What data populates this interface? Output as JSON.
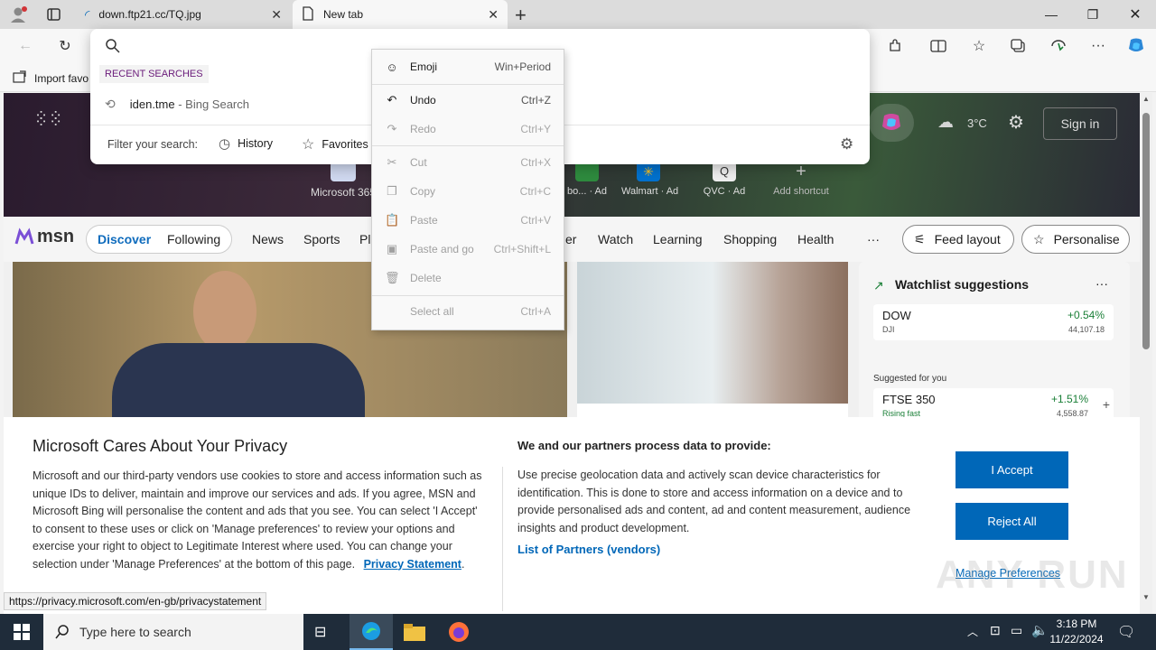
{
  "tabs": [
    {
      "label": "down.ftp21.cc/TQ.jpg",
      "close": "✕"
    },
    {
      "label": "New tab",
      "close": "✕"
    }
  ],
  "new_tab_symbol": "+",
  "favorites_bar": {
    "import_label": "Import favo"
  },
  "omnibox": {
    "recent_header": "RECENT SEARCHES",
    "recent_item_query": "iden.tme",
    "recent_item_suffix": " - Bing Search",
    "filter_label": "Filter your search:",
    "filter_history": "History",
    "filter_favorites": "Favorites"
  },
  "context_menu": [
    {
      "label": "Emoji",
      "key": "Win+Period",
      "enabled": true,
      "icon": "emoji-icon"
    },
    {
      "label": "Undo",
      "key": "Ctrl+Z",
      "enabled": true,
      "icon": "undo-icon"
    },
    {
      "label": "Redo",
      "key": "Ctrl+Y",
      "enabled": false,
      "icon": "redo-icon"
    },
    {
      "label": "Cut",
      "key": "Ctrl+X",
      "enabled": false,
      "icon": "cut-icon"
    },
    {
      "label": "Copy",
      "key": "Ctrl+C",
      "enabled": false,
      "icon": "copy-icon"
    },
    {
      "label": "Paste",
      "key": "Ctrl+V",
      "enabled": false,
      "icon": "paste-icon"
    },
    {
      "label": "Paste and go",
      "key": "Ctrl+Shift+L",
      "enabled": false,
      "icon": "paste-go-icon"
    },
    {
      "label": "Delete",
      "key": "",
      "enabled": false,
      "icon": "delete-icon"
    },
    {
      "label": "Select all",
      "key": "Ctrl+A",
      "enabled": false,
      "icon": ""
    }
  ],
  "hero": {
    "weather_temp": "3°C",
    "sign_in": "Sign in",
    "shortcuts": [
      {
        "label": "Microsoft 365"
      },
      {
        "label": "bo... · Ad"
      },
      {
        "label": "Walmart · Ad"
      },
      {
        "label": "QVC · Ad"
      },
      {
        "label": "Add shortcut"
      }
    ]
  },
  "msn": {
    "logo": "msn",
    "nav": [
      "Discover",
      "Following",
      "News",
      "Sports",
      "Pl",
      "er",
      "Watch",
      "Learning",
      "Shopping",
      "Health"
    ],
    "more": "···",
    "feed_layout": "Feed layout",
    "personalise": "Personalise"
  },
  "watchlist": {
    "title": "Watchlist suggestions",
    "more": "···",
    "items": [
      {
        "symbol": "DOW",
        "sub": "DJI",
        "change": "+0.54%",
        "value": "44,107.18"
      }
    ],
    "suggested_label": "Suggested for you",
    "suggested": [
      {
        "symbol": "FTSE 350",
        "sub": "Rising fast",
        "change": "+1.51%",
        "value": "4,558.87"
      }
    ]
  },
  "privacy": {
    "title": "Microsoft Cares About Your Privacy",
    "body": "Microsoft and our third-party vendors use cookies to store and access information such as unique IDs to deliver, maintain and improve our services and ads. If you agree, MSN and Microsoft Bing will personalise the content and ads that you see. You can select 'I Accept' to consent to these uses or click on 'Manage preferences' to review your options and exercise your right to object to Legitimate Interest where used.  You can change your selection under 'Manage Preferences' at the bottom of this page.",
    "statement_link": "Privacy Statement",
    "partners_title": "We and our partners process data to provide:",
    "partners_body": "Use precise geolocation data and actively scan device characteristics for identification. This is done to store and access information on a device and to provide personalised ads and content, ad and content measurement, audience insights and product development.",
    "partners_link": "List of Partners (vendors)",
    "accept": "I Accept",
    "reject": "Reject All",
    "manage": "Manage Preferences"
  },
  "status_url": "https://privacy.microsoft.com/en-gb/privacystatement",
  "taskbar": {
    "search_placeholder": "Type here to search",
    "time": "3:18 PM",
    "date": "11/22/2024"
  },
  "watermark": "ANY RUN",
  "colors": {
    "accent": "#0067b8",
    "msn_blue": "#0f6cbd",
    "green": "#1a7f37"
  }
}
